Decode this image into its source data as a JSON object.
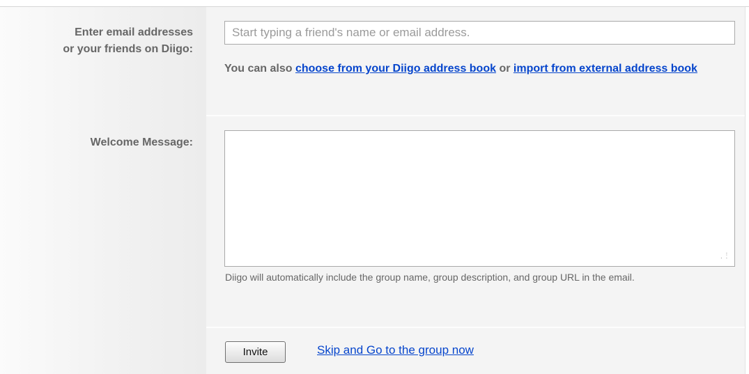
{
  "recipients": {
    "label_line1": "Enter email addresses",
    "label_line2": "or your friends on Diigo:",
    "input_placeholder": "Start typing a friend's name or email address.",
    "also_prefix": "You can also ",
    "address_book_link": "choose from your Diigo address book",
    "or_text": " or ",
    "import_link": "import from external address book"
  },
  "message": {
    "label": "Welcome Message:",
    "value": "",
    "note": "Diigo will automatically include the group name, group description, and group URL in the email."
  },
  "actions": {
    "invite_label": "Invite",
    "skip_label": "Skip and Go to the group now"
  }
}
